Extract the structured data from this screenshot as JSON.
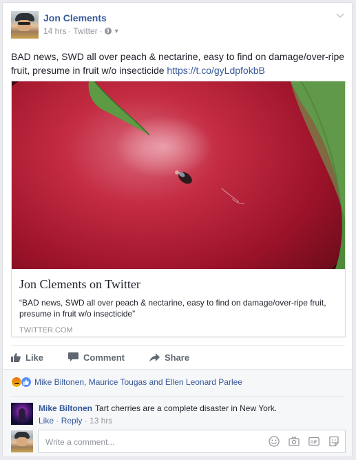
{
  "post": {
    "author": "Jon Clements",
    "time": "14 hrs",
    "source": "Twitter",
    "separator": "·",
    "text": "BAD news, SWD all over peach & nectarine, easy to find on damage/over-ripe fruit, presume in fruit w/o insecticide",
    "link_text": "https://t.co/gyLdpfokbB"
  },
  "link_card": {
    "title": "Jon Clements on Twitter",
    "description": "“BAD news, SWD all over peach & nectarine, easy to find on damage/over-ripe fruit, presume in fruit w/o insecticide”",
    "domain": "TWITTER.COM"
  },
  "actions": {
    "like": "Like",
    "comment": "Comment",
    "share": "Share"
  },
  "reactions": {
    "names": "Mike Biltonen, Maurice Tougas and Ellen Leonard Parlee",
    "icons": [
      "angry-reaction-icon",
      "like-reaction-icon"
    ]
  },
  "comment": {
    "author": "Mike Biltonen",
    "text": "Tart cherries are a complete disaster in New York.",
    "like": "Like",
    "reply": "Reply",
    "dot": "·",
    "time": "13 hrs"
  },
  "composer": {
    "placeholder": "Write a comment...",
    "tools": [
      "emoji-icon",
      "camera-icon",
      "gif-icon",
      "sticker-icon"
    ]
  },
  "colors": {
    "link": "#365899",
    "muted": "#90949c",
    "action": "#606770",
    "page_bg": "#e9ebee"
  }
}
